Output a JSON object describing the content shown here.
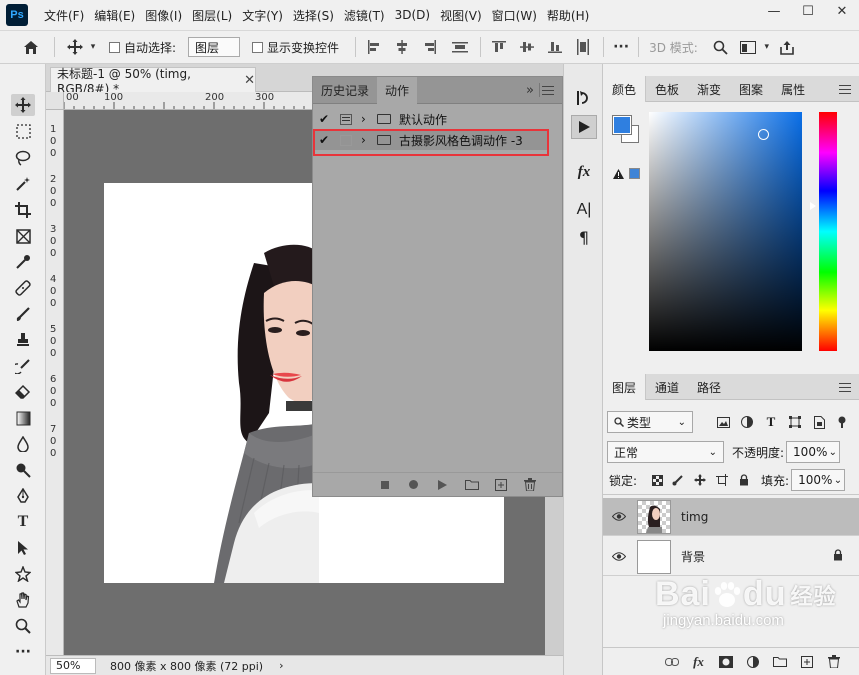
{
  "app": {
    "logo": "Ps",
    "menus": [
      "文件(F)",
      "编辑(E)",
      "图像(I)",
      "图层(L)",
      "文字(Y)",
      "选择(S)",
      "滤镜(T)",
      "3D(D)",
      "视图(V)",
      "窗口(W)",
      "帮助(H)"
    ],
    "window_controls": [
      "—",
      "☐",
      "✕"
    ]
  },
  "options": {
    "auto_select_label": "自动选择:",
    "auto_select_value": "图层",
    "show_transform_label": "显示变换控件",
    "more": "···",
    "mode_3d": "3D 模式:"
  },
  "document": {
    "tab_title": "未标题-1 @ 50% (timg, RGB/8#) *",
    "ruler_h": [
      "00",
      "100",
      "200",
      "300"
    ],
    "ruler_v": [
      "1",
      "0",
      "0",
      "2",
      "0",
      "0",
      "3",
      "0",
      "0",
      "4",
      "0",
      "0",
      "5",
      "0",
      "0",
      "6",
      "0",
      "0",
      "7",
      "0",
      "0"
    ],
    "zoom": "50%",
    "doc_info": "800 像素 x 800 像素 (72 ppi)"
  },
  "actions_panel": {
    "tabs": [
      "历史记录",
      "动作"
    ],
    "active_tab": "动作",
    "rows": [
      {
        "check": "✔",
        "name": "默认动作"
      },
      {
        "check": "✔",
        "name": "古摄影风格色调动作 -3"
      }
    ],
    "bottom_icons": [
      "stop",
      "record",
      "play",
      "folder",
      "new",
      "trash"
    ]
  },
  "color_panel": {
    "tabs": [
      "颜色",
      "色板",
      "渐变",
      "图案",
      "属性"
    ],
    "foreground": "#2f7fe0",
    "hue_color": "#0a6fe8"
  },
  "layers_panel": {
    "tabs": [
      "图层",
      "通道",
      "路径"
    ],
    "filter_kind": "类型",
    "blend_mode": "正常",
    "opacity_label": "不透明度:",
    "opacity_value": "100%",
    "lock_label": "锁定:",
    "fill_label": "填充:",
    "fill_value": "100%",
    "layers": [
      {
        "name": "timg",
        "selected": true
      },
      {
        "name": "背景",
        "selected": false,
        "locked": true
      }
    ]
  },
  "watermark": {
    "brand": "Bai",
    "brand2": "du",
    "suffix": "经验",
    "url": "jingyan.baidu.com"
  }
}
